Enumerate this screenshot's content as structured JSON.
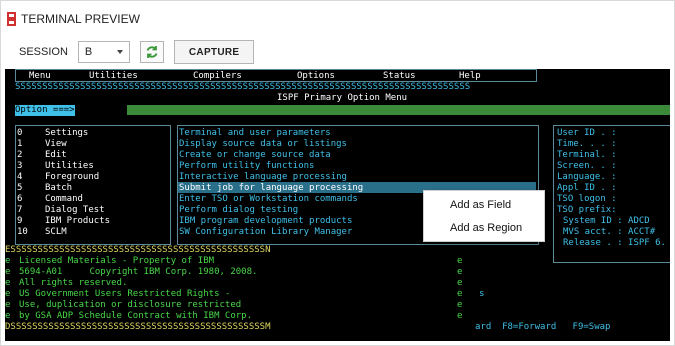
{
  "window": {
    "title": "TERMINAL PREVIEW"
  },
  "toolbar": {
    "session_label": "SESSION",
    "session_value": "B",
    "capture_label": "CAPTURE"
  },
  "terminal": {
    "menu": [
      "Menu",
      "Utilities",
      "Compilers",
      "Options",
      "Status",
      "Help"
    ],
    "sep_top": "SSSSSSSSSSSSSSSSSSSSSSSSSSSSSSSSSSSSSSSSSSSSSSSSSSSSSSSSSSSSSSSSSSSSSSSSSSSSSSSSSSSS",
    "panel_title": "ISPF Primary Option Menu",
    "option_prompt": "Option ===>",
    "options": [
      {
        "num": "0",
        "name": "Settings",
        "desc": "Terminal and user parameters"
      },
      {
        "num": "1",
        "name": "View",
        "desc": "Display source data or listings"
      },
      {
        "num": "2",
        "name": "Edit",
        "desc": "Create or change source data"
      },
      {
        "num": "3",
        "name": "Utilities",
        "desc": "Perform utility functions"
      },
      {
        "num": "4",
        "name": "Foreground",
        "desc": "Interactive language processing"
      },
      {
        "num": "5",
        "name": "Batch",
        "desc": "Submit job for language processing"
      },
      {
        "num": "6",
        "name": "Command",
        "desc": "Enter TSO or Workstation commands"
      },
      {
        "num": "7",
        "name": "Dialog Test",
        "desc": "Perform dialog testing"
      },
      {
        "num": "9",
        "name": "IBM Products",
        "desc": "IBM program development products"
      },
      {
        "num": "10",
        "name": "SCLM",
        "desc": "SW Configuration Library Manager"
      }
    ],
    "info": [
      "User ID . :",
      "Time. . . :",
      "Terminal. :",
      "Screen. . :",
      "Language. :",
      "Appl ID . :",
      "TSO logon :",
      "TSO prefix:",
      "System ID : ADCD",
      "MVS acct. : ACCT#",
      "Release . : ISPF 6."
    ],
    "sep_mid": "ESSSSSSSSSSSSSSSSSSSSSSSSSSSSSSSSSSSSSSSSSSSSSSSN",
    "license": [
      "Licensed Materials - Property of IBM",
      "5694-A01     Copyright IBM Corp. 1980, 2008.",
      "All rights reserved.",
      "",
      "US Government Users Restricted Rights -",
      "Use, duplication or disclosure restricted",
      "by GSA ADP Schedule Contract with IBM Corp."
    ],
    "sep_bot": "DSSSSSSSSSSSSSSSSSSSSSSSSSSSSSSSSSSSSSSSSSSSSSSSM",
    "fkeys": "ard  F8=Forward   F9=Swap"
  },
  "context_menu": {
    "items": [
      "Add as Field",
      "Add as Region"
    ]
  }
}
